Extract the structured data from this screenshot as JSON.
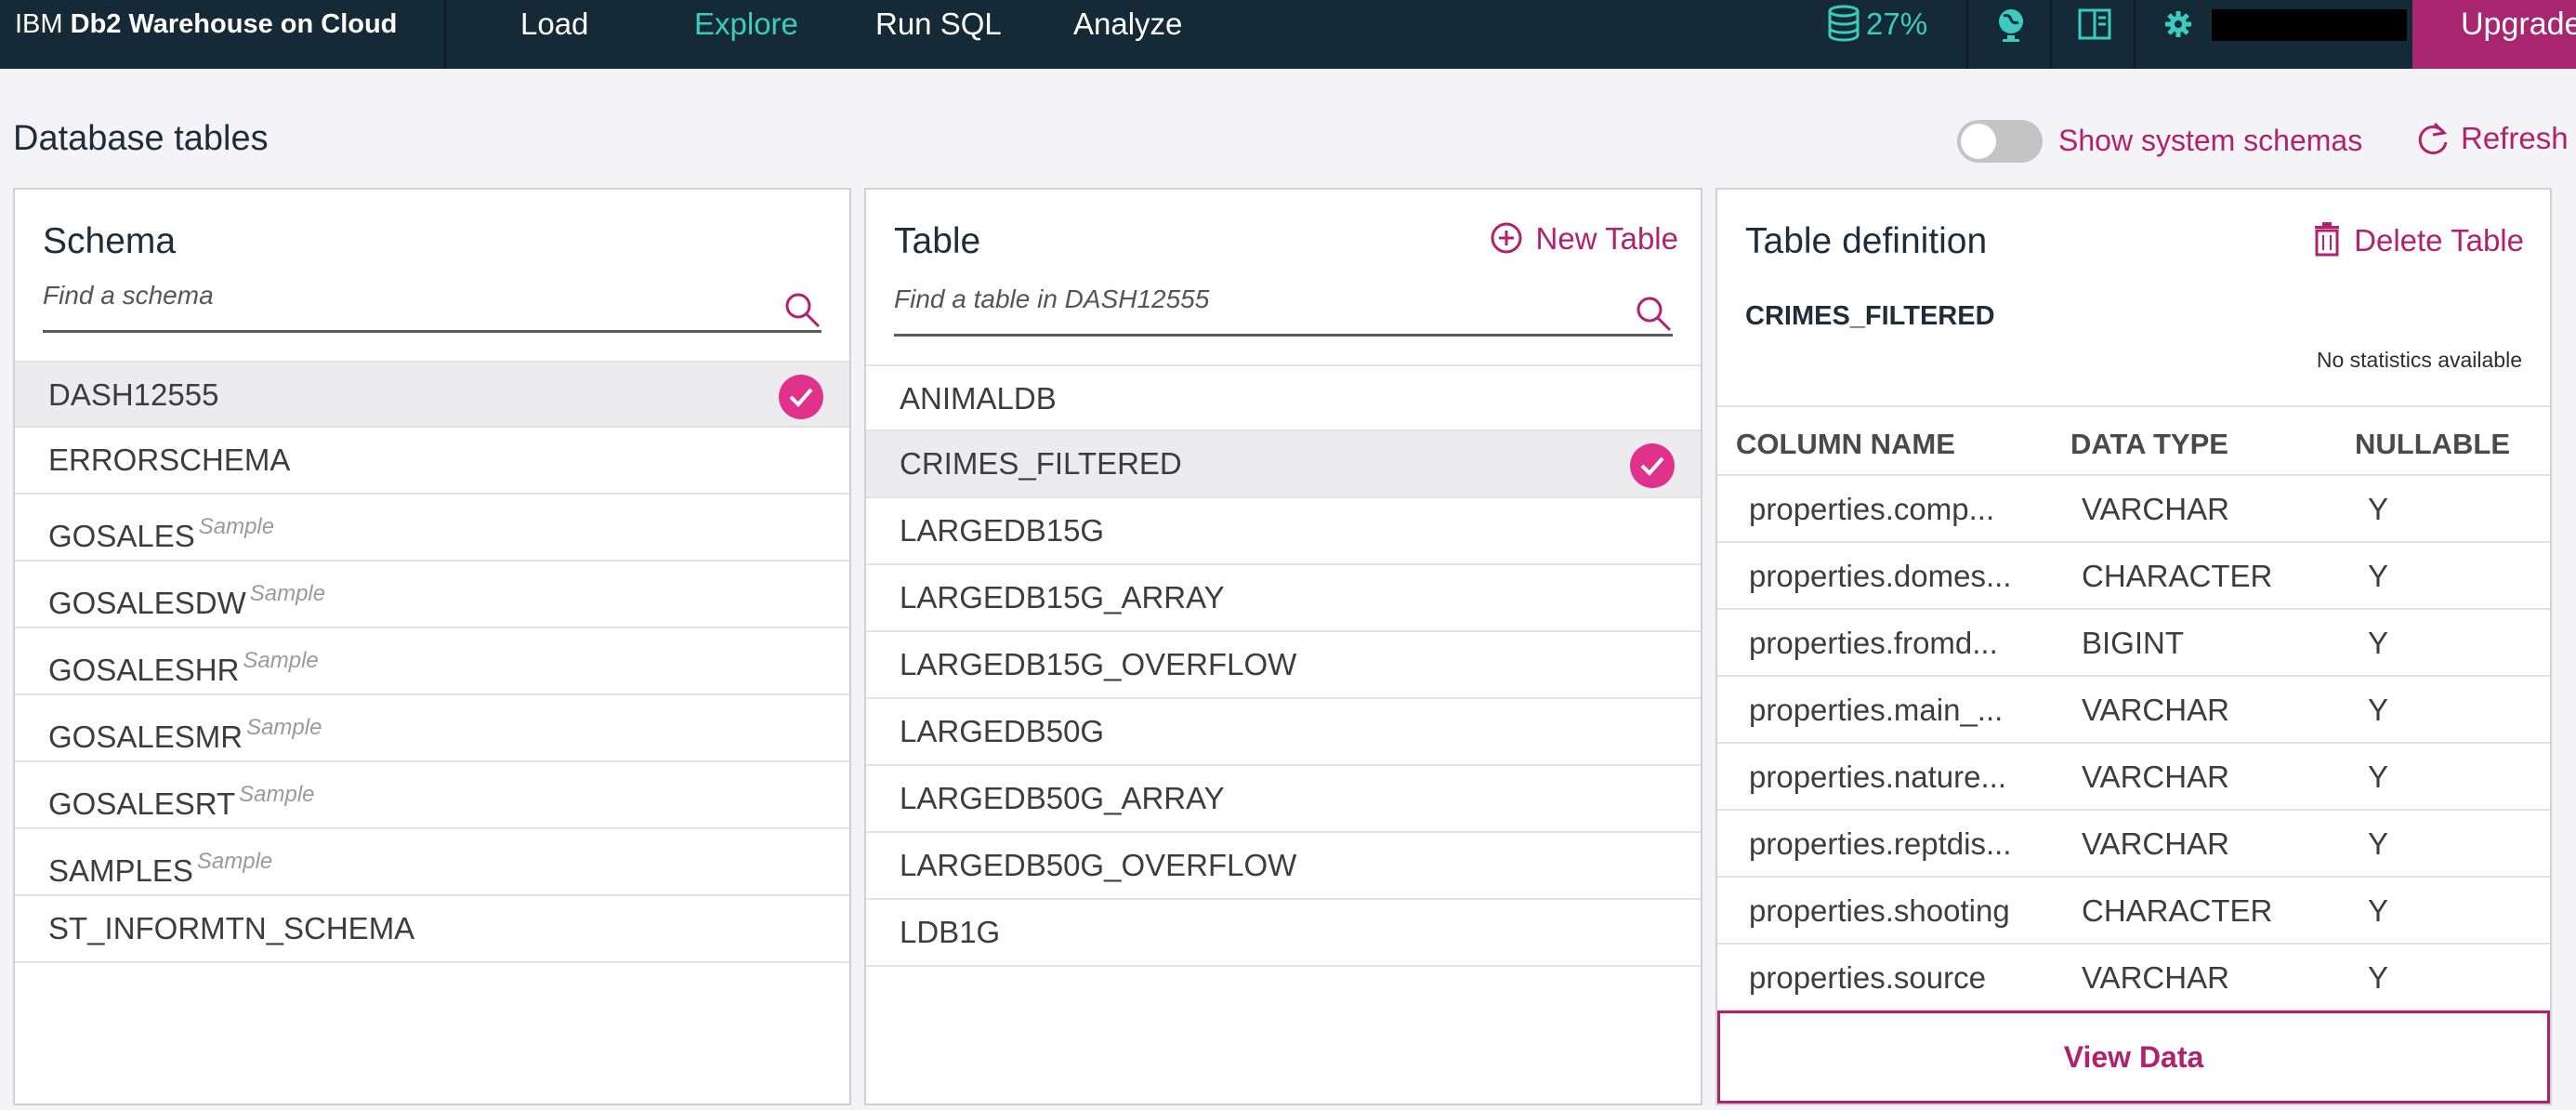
{
  "app": {
    "brand_prefix": "IBM",
    "brand_name": "Db2 Warehouse on Cloud",
    "nav": [
      "Load",
      "Explore",
      "Run SQL",
      "Analyze"
    ],
    "active_nav": "Explore",
    "storage_usage": "27%",
    "upgrade_label": "Upgrade",
    "accent_color": "#b2216e",
    "active_color": "#3ecbbf"
  },
  "page": {
    "title": "Database tables",
    "show_system_schemas_label": "Show system schemas",
    "show_system_schemas_on": false,
    "refresh_label": "Refresh"
  },
  "schema_panel": {
    "title": "Schema",
    "search_placeholder": "Find a schema",
    "selected": "DASH12555",
    "items": [
      {
        "name": "DASH12555",
        "tag": ""
      },
      {
        "name": "ERRORSCHEMA",
        "tag": ""
      },
      {
        "name": "GOSALES",
        "tag": "Sample"
      },
      {
        "name": "GOSALESDW",
        "tag": "Sample"
      },
      {
        "name": "GOSALESHR",
        "tag": "Sample"
      },
      {
        "name": "GOSALESMR",
        "tag": "Sample"
      },
      {
        "name": "GOSALESRT",
        "tag": "Sample"
      },
      {
        "name": "SAMPLES",
        "tag": "Sample"
      },
      {
        "name": "ST_INFORMTN_SCHEMA",
        "tag": ""
      }
    ]
  },
  "table_panel": {
    "title": "Table",
    "new_table_label": "New Table",
    "search_placeholder": "Find a table in DASH12555",
    "selected": "CRIMES_FILTERED",
    "items": [
      "ANIMALDB",
      "CRIMES_FILTERED",
      "LARGEDB15G",
      "LARGEDB15G_ARRAY",
      "LARGEDB15G_OVERFLOW",
      "LARGEDB50G",
      "LARGEDB50G_ARRAY",
      "LARGEDB50G_OVERFLOW",
      "LDB1G"
    ]
  },
  "definition_panel": {
    "title": "Table definition",
    "delete_label": "Delete Table",
    "table_name": "CRIMES_FILTERED",
    "stats": "No statistics available",
    "headers": [
      "COLUMN NAME",
      "DATA TYPE",
      "NULLABLE"
    ],
    "rows": [
      [
        "properties.comp...",
        "VARCHAR",
        "Y"
      ],
      [
        "properties.domes...",
        "CHARACTER",
        "Y"
      ],
      [
        "properties.fromd...",
        "BIGINT",
        "Y"
      ],
      [
        "properties.main_...",
        "VARCHAR",
        "Y"
      ],
      [
        "properties.nature...",
        "VARCHAR",
        "Y"
      ],
      [
        "properties.reptdis...",
        "VARCHAR",
        "Y"
      ],
      [
        "properties.shooting",
        "CHARACTER",
        "Y"
      ],
      [
        "properties.source",
        "VARCHAR",
        "Y"
      ]
    ],
    "view_data_label": "View Data"
  }
}
